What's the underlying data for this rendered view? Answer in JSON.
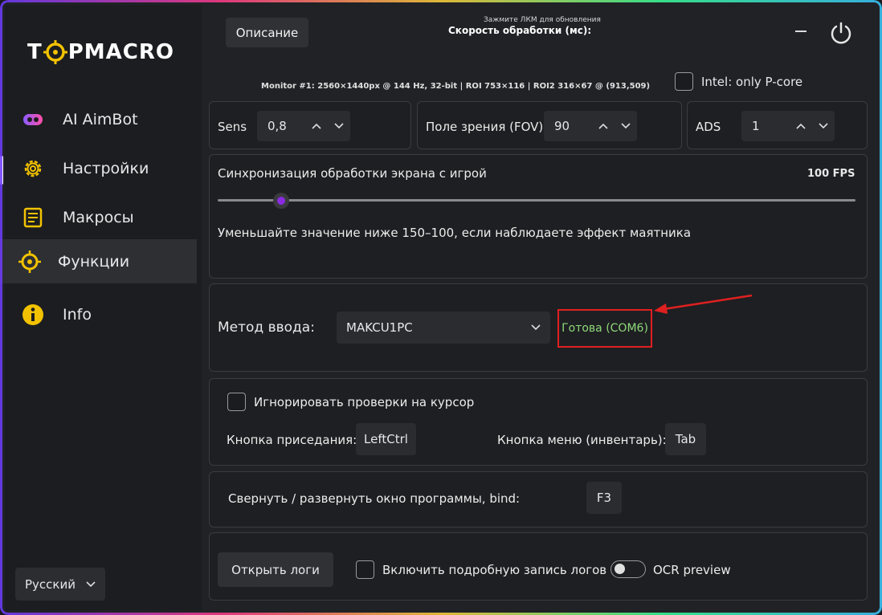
{
  "app": {
    "name_left": "T",
    "name_right": "PMACRO"
  },
  "sidebar": {
    "items": [
      {
        "label": "AI AimBot",
        "icon": "gamepad-icon"
      },
      {
        "label": "Настройки",
        "icon": "gear-icon"
      },
      {
        "label": "Макросы",
        "icon": "document-icon"
      },
      {
        "label": "Функции",
        "icon": "crosshair-icon"
      },
      {
        "label": "Info",
        "icon": "info-icon"
      }
    ],
    "language": "Русский"
  },
  "header": {
    "description_button": "Описание",
    "hint": "Зажмите ЛКМ для обновления",
    "speed_label": "Скорость обработки (мс):",
    "monitor_info": "Monitor #1: 2560×1440px @ 144 Hz, 32-bit | ROI 753×116 | ROI2 316×67 @ (913,509)",
    "intel_label": "Intel: only P-core"
  },
  "params": {
    "sens_label": "Sens",
    "sens_value": "0,8",
    "fov_label": "Поле зрения (FOV)",
    "fov_value": "90",
    "ads_label": "ADS",
    "ads_value": "1"
  },
  "sync": {
    "label": "Синхронизация обработки экрана с игрой",
    "fps": "100 FPS",
    "hint": "Уменьшайте значение ниже 150–100, если наблюдаете эффект маятника",
    "slider_fraction": 0.1
  },
  "input": {
    "label": "Метод ввода:",
    "selected": "MAKCU1PC",
    "status": "Готова (COM6)",
    "status_color": "#8fd87a"
  },
  "cursor": {
    "ignore_label": "Игнорировать проверки на курсор",
    "crouch_label": "Кнопка приседания:",
    "crouch_key": "LeftCtrl",
    "menu_label": "Кнопка меню (инвентарь):",
    "menu_key": "Tab"
  },
  "bind": {
    "label": "Свернуть / развернуть окно программы, bind:",
    "key": "F3"
  },
  "logs": {
    "open_button": "Открыть логи",
    "verbose_label": "Включить подробную запись логов",
    "ocr_label": "OCR preview"
  },
  "colors": {
    "accent": "#8a2be2",
    "annotation": "#e02020",
    "icon_yellow": "#f2c200"
  }
}
